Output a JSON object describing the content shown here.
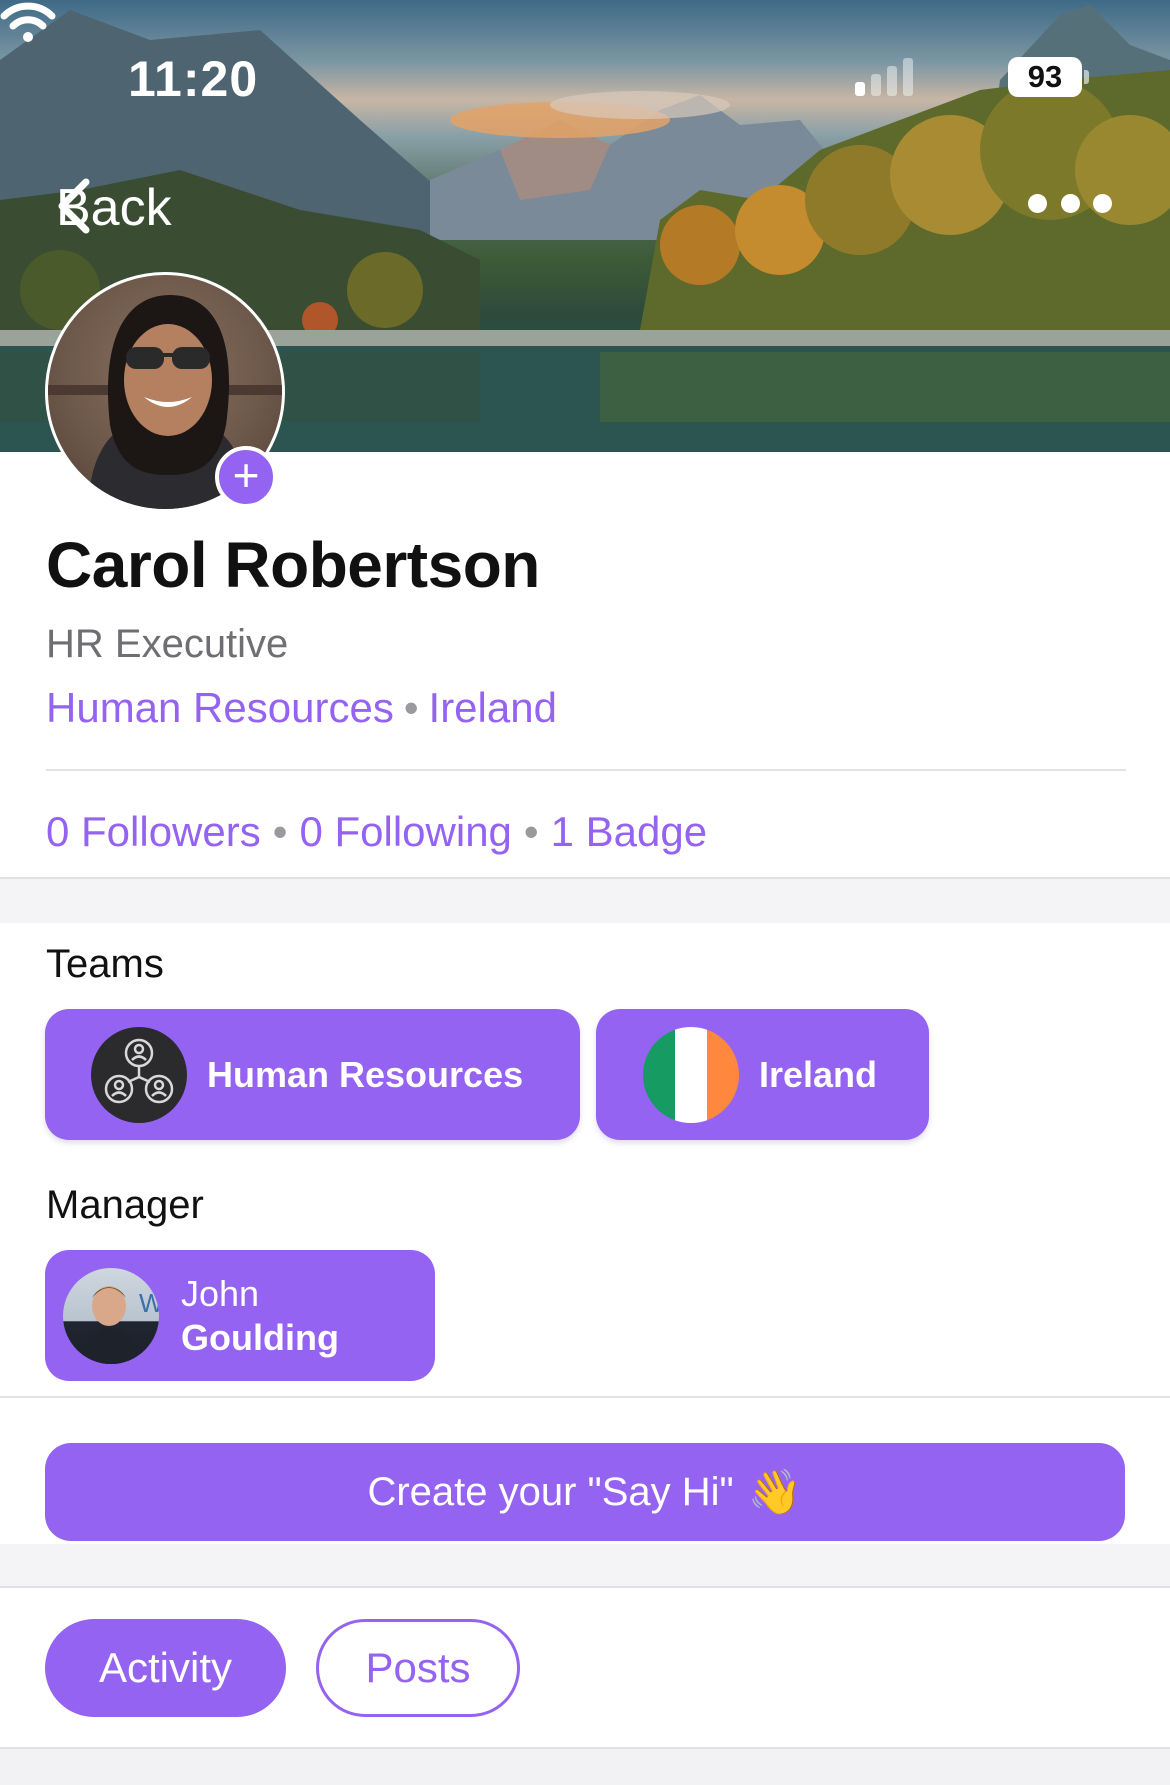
{
  "status_bar": {
    "time": "11:20",
    "battery": "93",
    "icons": [
      "signal-icon",
      "wifi-icon",
      "battery-icon"
    ]
  },
  "nav": {
    "back_label": "Back",
    "more_icon": "more-horizontal-icon"
  },
  "profile": {
    "name": "Carol Robertson",
    "job_title": "HR Executive",
    "department": "Human Resources",
    "location": "Ireland",
    "separator": "•",
    "avatar_add_icon": "+"
  },
  "stats": {
    "followers": "0 Followers",
    "following": "0 Following",
    "badges": "1 Badge",
    "separator": "•"
  },
  "teams": {
    "label": "Teams",
    "items": [
      {
        "label": "Human Resources",
        "icon": "team-people-icon"
      },
      {
        "label": "Ireland",
        "icon": "ireland-flag-icon"
      }
    ]
  },
  "manager": {
    "label": "Manager",
    "first_name": "John",
    "last_name": "Goulding"
  },
  "cta": {
    "label": "Create your \"Say Hi\"",
    "emoji": "👋"
  },
  "tabs": [
    {
      "label": "Activity",
      "active": true
    },
    {
      "label": "Posts",
      "active": false
    }
  ],
  "colors": {
    "accent": "#9563f1",
    "secondary_text": "#6e6e73",
    "flag_green": "#169b62",
    "flag_white": "#ffffff",
    "flag_orange": "#ff883e"
  }
}
